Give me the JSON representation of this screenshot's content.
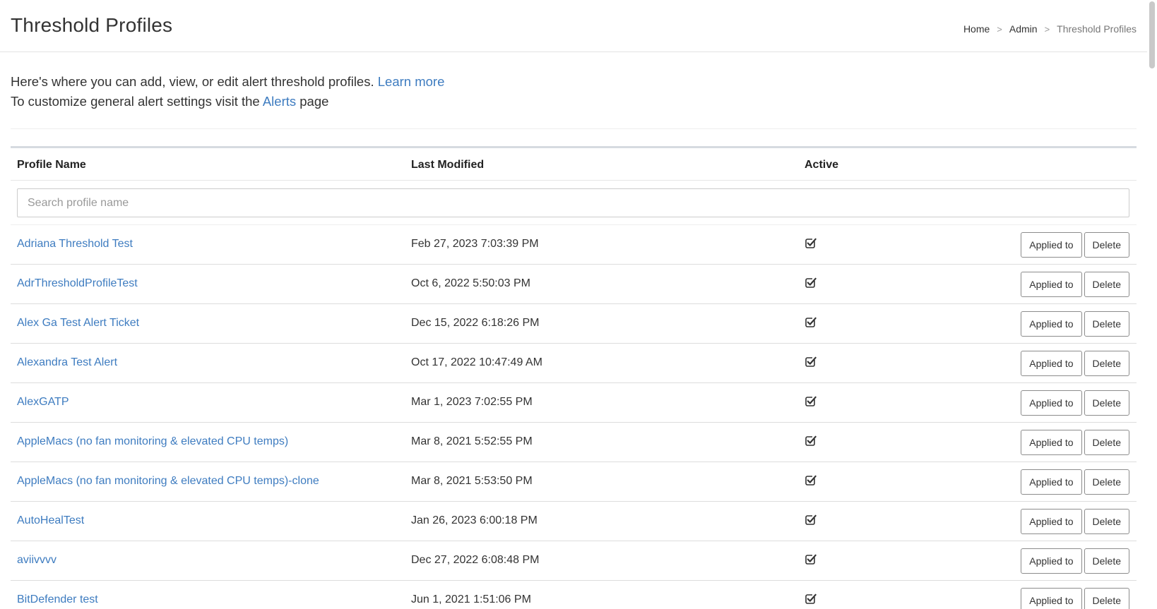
{
  "header": {
    "title": "Threshold Profiles",
    "breadcrumb": {
      "home": "Home",
      "admin": "Admin",
      "current": "Threshold Profiles",
      "separator": ">"
    }
  },
  "intro": {
    "line1_text": "Here's where you can add, view, or edit alert threshold profiles.",
    "line1_link": "Learn more",
    "line2_before": "To customize general alert settings visit the",
    "line2_link": "Alerts",
    "line2_after": "page"
  },
  "table": {
    "columns": {
      "name": "Profile Name",
      "last_modified": "Last Modified",
      "active": "Active"
    },
    "search": {
      "placeholder": "Search profile name",
      "value": ""
    },
    "actions": {
      "applied_to": "Applied to",
      "delete": "Delete"
    },
    "rows": [
      {
        "name": "Adriana Threshold Test",
        "last_modified": "Feb 27, 2023 7:03:39 PM",
        "active": true
      },
      {
        "name": "AdrThresholdProfileTest",
        "last_modified": "Oct 6, 2022 5:50:03 PM",
        "active": true
      },
      {
        "name": "Alex Ga Test Alert Ticket",
        "last_modified": "Dec 15, 2022 6:18:26 PM",
        "active": true
      },
      {
        "name": "Alexandra Test Alert",
        "last_modified": "Oct 17, 2022 10:47:49 AM",
        "active": true
      },
      {
        "name": "AlexGATP",
        "last_modified": "Mar 1, 2023 7:02:55 PM",
        "active": true
      },
      {
        "name": "AppleMacs (no fan monitoring & elevated CPU temps)",
        "last_modified": "Mar 8, 2021 5:52:55 PM",
        "active": true
      },
      {
        "name": "AppleMacs (no fan monitoring & elevated CPU temps)-clone",
        "last_modified": "Mar 8, 2021 5:53:50 PM",
        "active": true
      },
      {
        "name": "AutoHealTest",
        "last_modified": "Jan 26, 2023 6:00:18 PM",
        "active": true
      },
      {
        "name": "aviivvvv",
        "last_modified": "Dec 27, 2022 6:08:48 PM",
        "active": true
      },
      {
        "name": "BitDefender test",
        "last_modified": "Jun 1, 2021 1:51:06 PM",
        "active": true
      }
    ]
  },
  "colors": {
    "link": "#3e7cc0",
    "text": "#333333",
    "border": "#dddddd"
  },
  "icons": {
    "active": "checked-checkbox-icon"
  }
}
